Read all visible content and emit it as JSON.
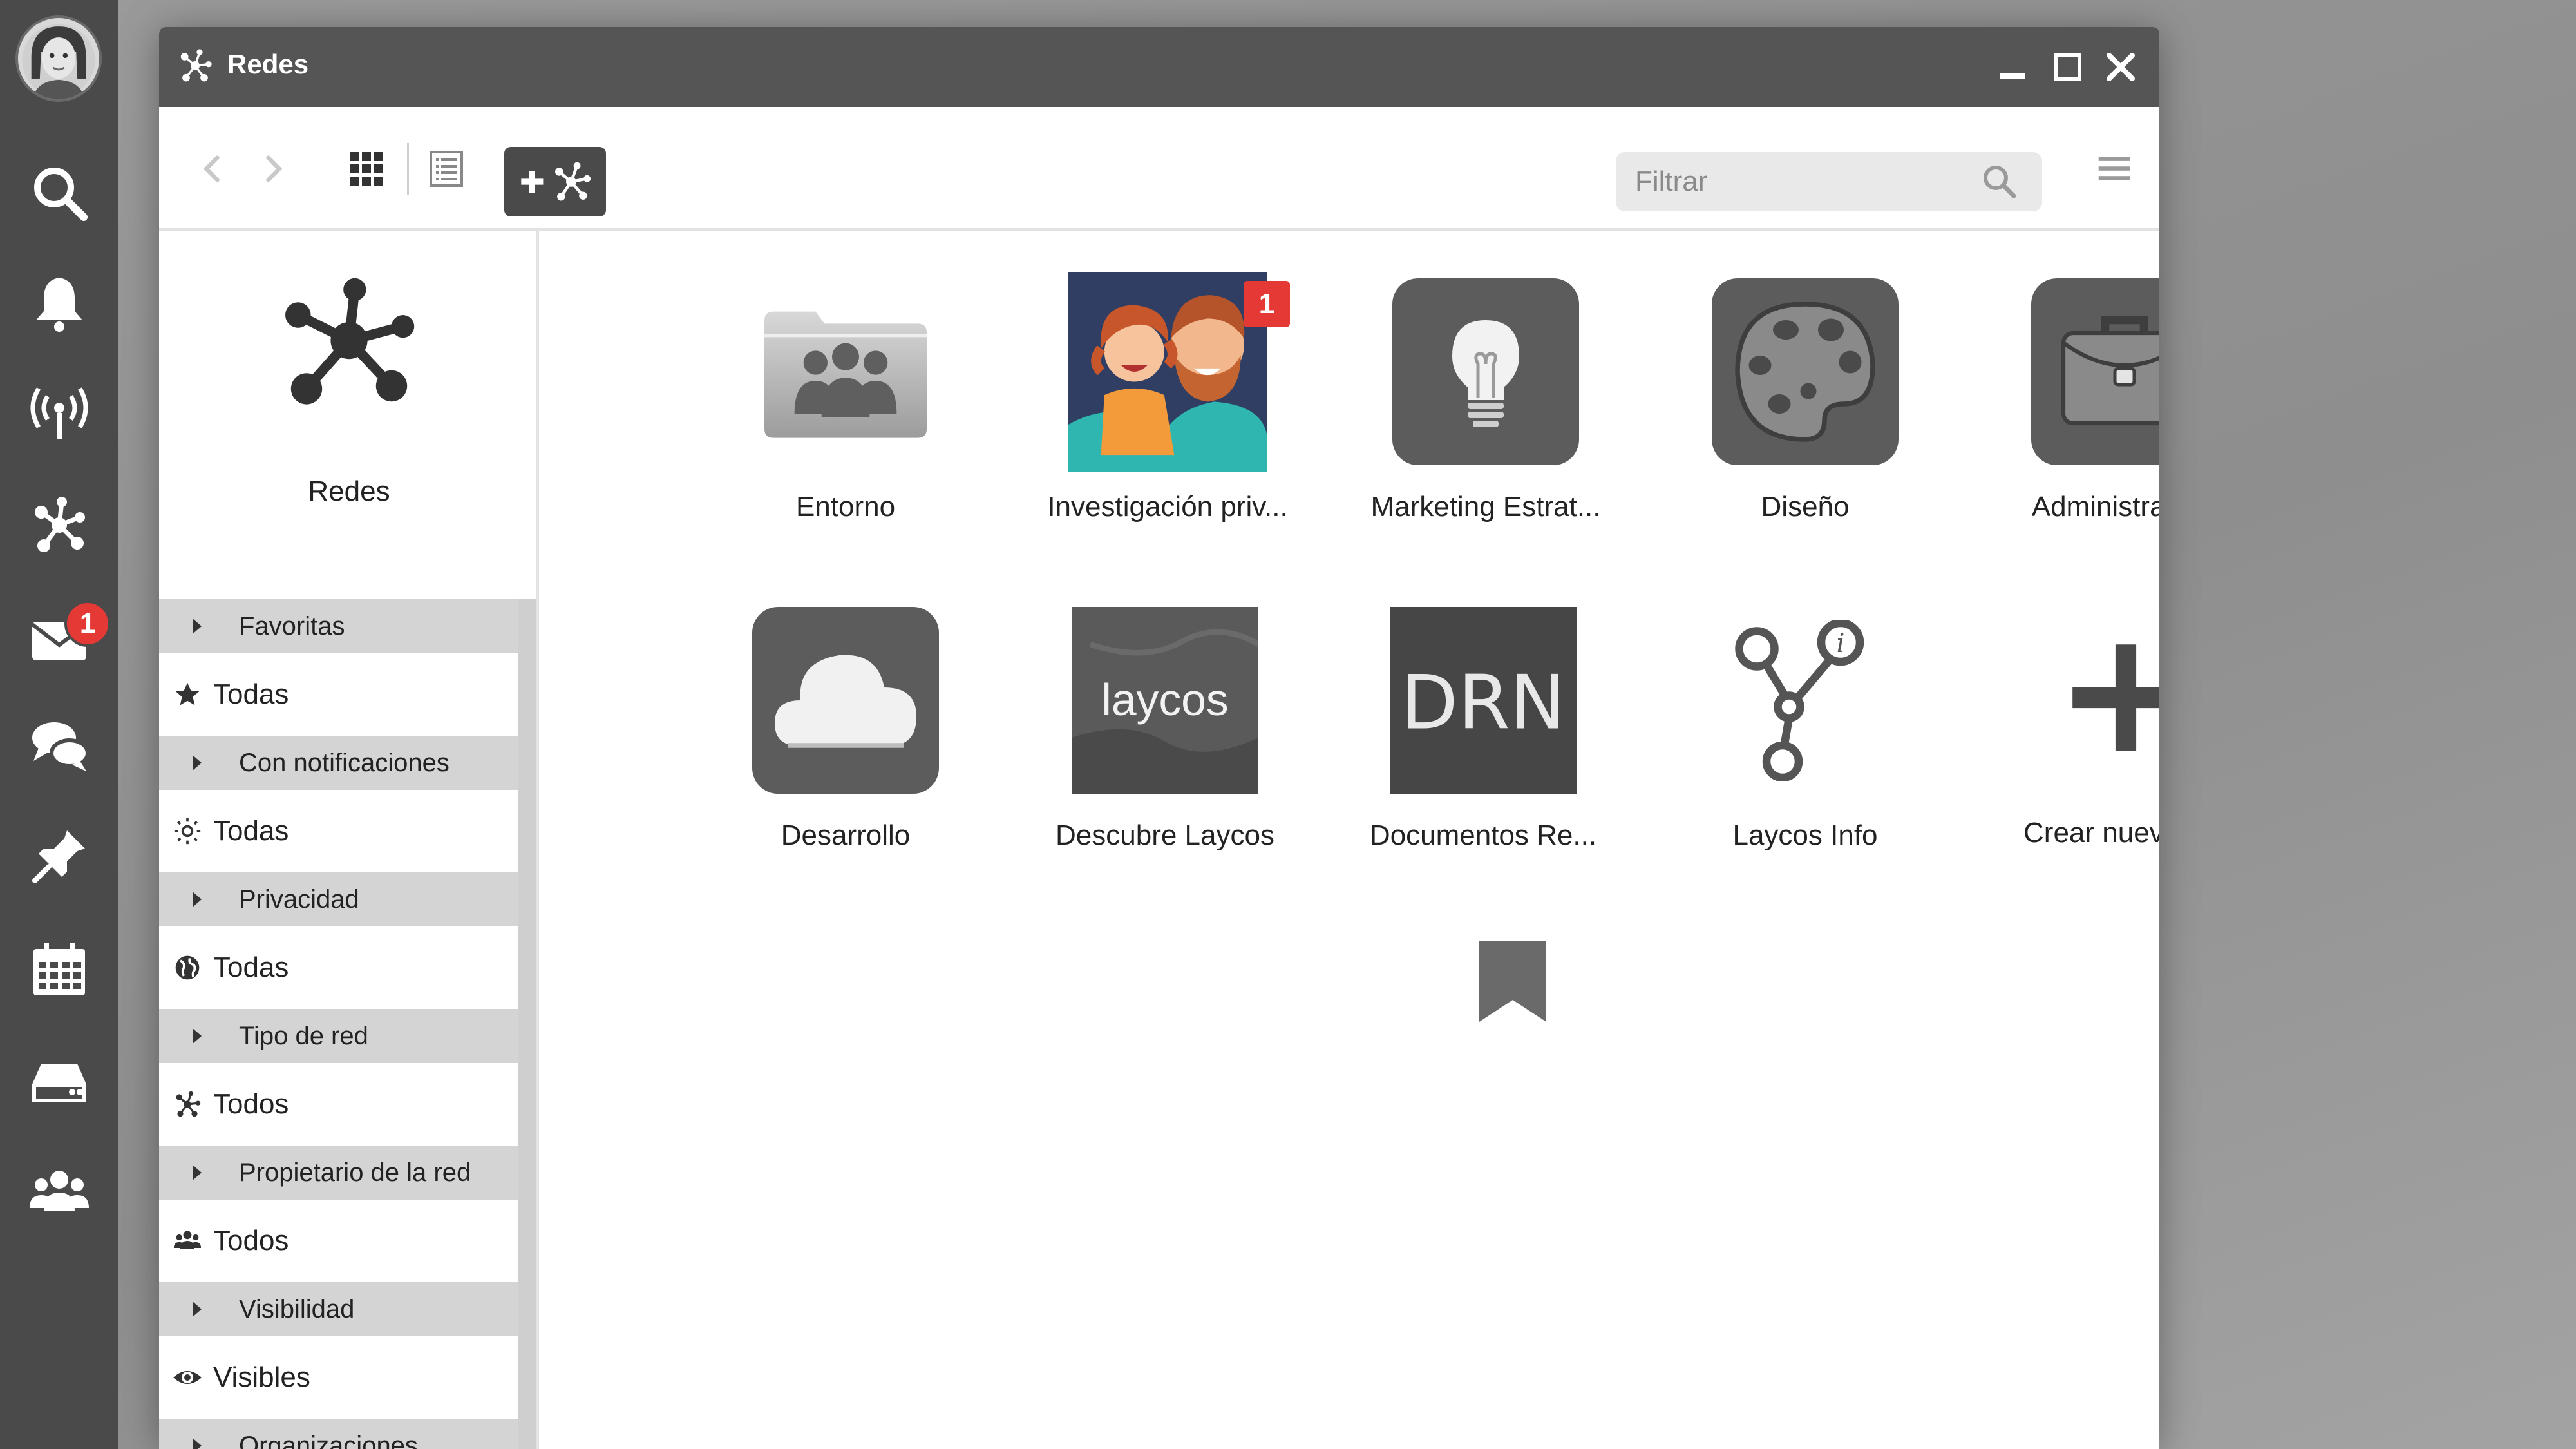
{
  "window": {
    "title": "Redes"
  },
  "toolbar": {
    "filter_placeholder": "Filtrar"
  },
  "sidebar": {
    "header_label": "Redes",
    "groups": [
      {
        "section": "Favoritas",
        "option": "Todas",
        "icon": "star-icon"
      },
      {
        "section": "Con notificaciones",
        "option": "Todas",
        "icon": "sun-icon"
      },
      {
        "section": "Privacidad",
        "option": "Todas",
        "icon": "globe-icon"
      },
      {
        "section": "Tipo de red",
        "option": "Todos",
        "icon": "network-icon"
      },
      {
        "section": "Propietario de la red",
        "option": "Todos",
        "icon": "users-icon"
      },
      {
        "section": "Visibilidad",
        "option": "Visibles",
        "icon": "eye-icon"
      },
      {
        "section": "Organizaciones"
      }
    ]
  },
  "dock": {
    "mail_badge": "1"
  },
  "networks": [
    {
      "name": "Entorno",
      "icon": "folder-users-icon"
    },
    {
      "name": "Investigación priv...",
      "icon": "family-photo",
      "badge": "1"
    },
    {
      "name": "Marketing Estrat...",
      "icon": "lightbulb-icon"
    },
    {
      "name": "Diseño",
      "icon": "palette-icon"
    },
    {
      "name": "Administración",
      "icon": "briefcase-icon"
    },
    {
      "name": "Desarrollo",
      "icon": "cloud-icon"
    },
    {
      "name": "Descubre Laycos",
      "icon": "laycos-logo",
      "logo_text": "laycos"
    },
    {
      "name": "Documentos Re...",
      "icon": "drn-logo",
      "logo_text": "DRN"
    },
    {
      "name": "Laycos Info",
      "icon": "info-branch-icon"
    },
    {
      "name": "Crear nueva red",
      "icon": "plus-icon"
    }
  ]
}
